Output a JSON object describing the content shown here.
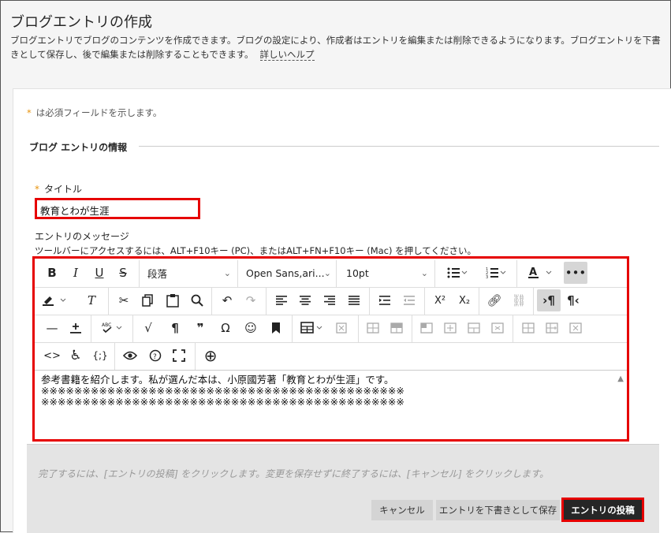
{
  "header": {
    "title": "ブログエントリの作成",
    "description": "ブログエントリでブログのコンテンツを作成できます。ブログの設定により、作成者はエントリを編集または削除できるようになります。ブログエントリを下書きとして保存し、後で編集または削除することもできます。",
    "help_link": "詳しいヘルプ"
  },
  "form": {
    "required_note": "は必須フィールドを示します。",
    "required_mark": "*",
    "section_title": "ブログ エントリの情報",
    "title_label": "タイトル",
    "title_value": "教育とわが生涯",
    "message_label": "エントリのメッセージ",
    "toolbar_help": "ツールバーにアクセスするには、ALT+F10キー (PC)、またはALT+FN+F10キー (Mac) を押してください。"
  },
  "editor": {
    "block_format": "段落",
    "font_family": "Open Sans,ari...",
    "font_size": "10pt",
    "content_line1": "参考書籍を紹介します。私が選んだ本は、小原國芳著「教育とわが生涯」です。",
    "content_line2": "※※※※※※※※※※※※※※※※※※※※※※※※※※※※※※※※※※※※※※※※※※※※",
    "content_line3": "※※※※※※※※※※※※※※※※※※※※※※※※※※※※※※※※※※※※※※※※※※※※"
  },
  "icons": {
    "bold": "B",
    "italic": "I",
    "underline": "U",
    "strike": "S",
    "more": "•••",
    "clear": "T",
    "paragraph_marks": "¶",
    "ltr": "¶",
    "rtl": "¶",
    "special_char": "Ω",
    "quote": "❞",
    "emoji": "☺",
    "accessibility": "♿",
    "add": "⊕",
    "superscript": "X²",
    "subscript": "X₂"
  },
  "footer": {
    "message": "完了するには、[エントリの投稿] をクリックします。変更を保存せずに終了するには、[キャンセル] をクリックします。",
    "cancel_label": "キャンセル",
    "draft_label": "エントリを下書きとして保存",
    "post_label": "エントリの投稿"
  },
  "colors": {
    "highlight": "#e60000",
    "required": "#e8930c",
    "primary_button": "#262626"
  }
}
